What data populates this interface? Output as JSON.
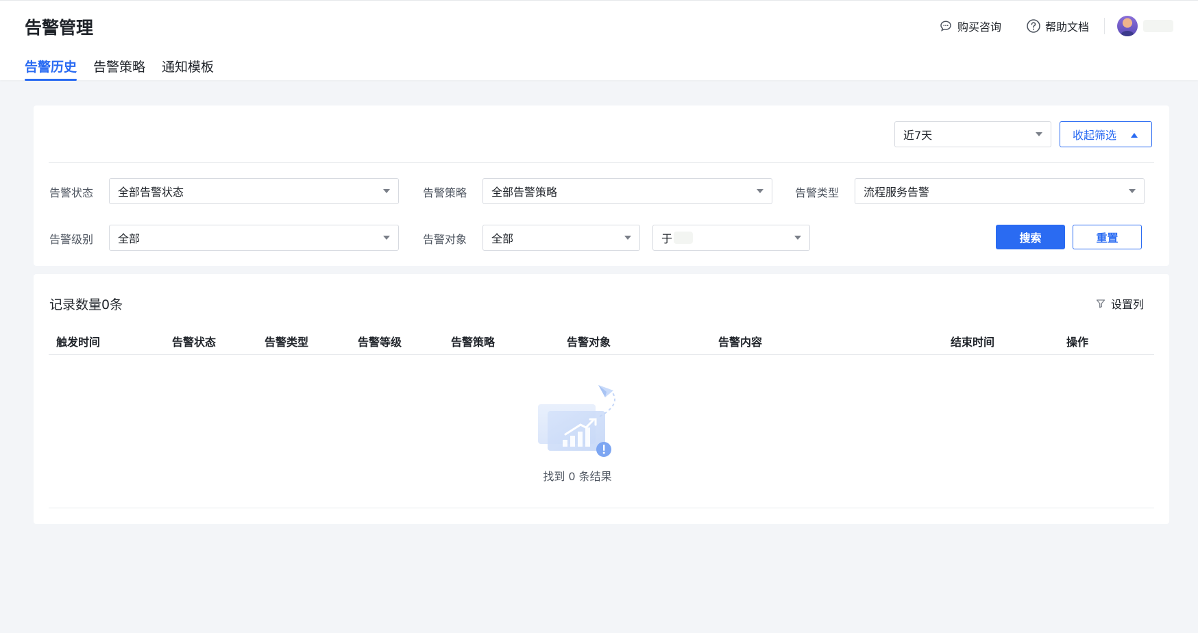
{
  "header": {
    "title": "告警管理",
    "tabs": [
      {
        "label": "告警历史",
        "active": true
      },
      {
        "label": "告警策略",
        "active": false
      },
      {
        "label": "通知模板",
        "active": false
      }
    ],
    "actions": {
      "purchase_label": "购买咨询",
      "help_label": "帮助文档"
    }
  },
  "filters": {
    "period": "近7天",
    "collapse_label": "收起筛选",
    "status_label": "告警状态",
    "status_value": "全部告警状态",
    "policy_label": "告警策略",
    "policy_value": "全部告警策略",
    "type_label": "告警类型",
    "type_value": "流程服务告警",
    "level_label": "告警级别",
    "level_value": "全部",
    "target_label": "告警对象",
    "target_value": "全部",
    "target_sub_value": "于",
    "search_label": "搜索",
    "reset_label": "重置"
  },
  "table": {
    "record_count": "记录数量0条",
    "set_columns_label": "设置列",
    "columns": [
      "触发时间",
      "告警状态",
      "告警类型",
      "告警等级",
      "告警策略",
      "告警对象",
      "告警内容",
      "结束时间",
      "操作"
    ],
    "empty_text": "找到 0 条结果"
  },
  "colors": {
    "accent": "#2a6bf2",
    "background": "#f3f5f8"
  }
}
